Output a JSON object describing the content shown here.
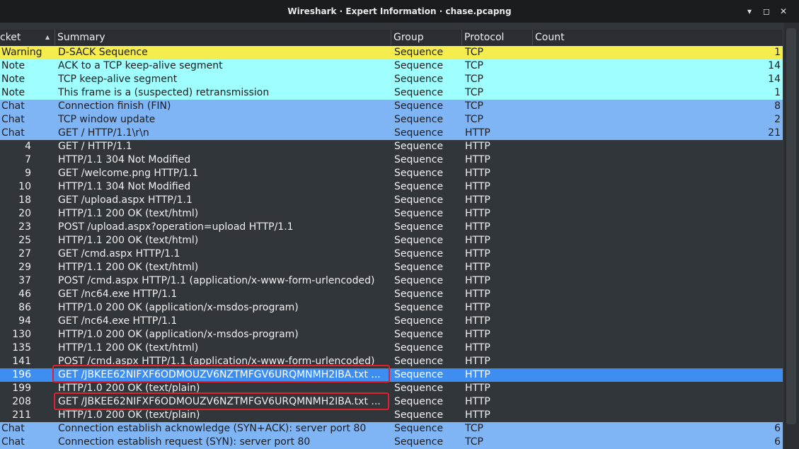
{
  "window": {
    "title": "Wireshark · Expert Information · chase.pcapng",
    "minimize_glyph": "▾",
    "restore_glyph": "◻",
    "maximize_glyph": "▴",
    "close_glyph": "✕"
  },
  "columns": {
    "packet": "cket",
    "summary": "Summary",
    "group": "Group",
    "protocol": "Protocol",
    "count": "Count"
  },
  "colors": {
    "warning": "#f5ed4e",
    "note": "#9fffff",
    "chat": "#7fb4f5",
    "selected": "#3d8ef0",
    "highlight_box": "#e0202a"
  },
  "rows": [
    {
      "kind": "warning",
      "packet": "Warning",
      "summary": "D-SACK Sequence",
      "group": "Sequence",
      "protocol": "TCP",
      "count": "1"
    },
    {
      "kind": "note",
      "packet": "Note",
      "summary": "ACK to a TCP keep-alive segment",
      "group": "Sequence",
      "protocol": "TCP",
      "count": "14"
    },
    {
      "kind": "note",
      "packet": "Note",
      "summary": "TCP keep-alive segment",
      "group": "Sequence",
      "protocol": "TCP",
      "count": "14"
    },
    {
      "kind": "note",
      "packet": "Note",
      "summary": "This frame is a (suspected) retransmission",
      "group": "Sequence",
      "protocol": "TCP",
      "count": "1"
    },
    {
      "kind": "chat",
      "packet": "Chat",
      "summary": "Connection finish (FIN)",
      "group": "Sequence",
      "protocol": "TCP",
      "count": "8"
    },
    {
      "kind": "chat",
      "packet": "Chat",
      "summary": "TCP window update",
      "group": "Sequence",
      "protocol": "TCP",
      "count": "2"
    },
    {
      "kind": "chat",
      "packet": "Chat",
      "summary": "GET / HTTP/1.1\\r\\n",
      "group": "Sequence",
      "protocol": "HTTP",
      "count": "21"
    },
    {
      "kind": "pkt",
      "packet": "4",
      "summary": "GET / HTTP/1.1",
      "group": "Sequence",
      "protocol": "HTTP",
      "count": ""
    },
    {
      "kind": "pkt",
      "packet": "7",
      "summary": "HTTP/1.1 304 Not Modified",
      "group": "Sequence",
      "protocol": "HTTP",
      "count": ""
    },
    {
      "kind": "pkt",
      "packet": "9",
      "summary": "GET /welcome.png HTTP/1.1",
      "group": "Sequence",
      "protocol": "HTTP",
      "count": ""
    },
    {
      "kind": "pkt",
      "packet": "10",
      "summary": "HTTP/1.1 304 Not Modified",
      "group": "Sequence",
      "protocol": "HTTP",
      "count": ""
    },
    {
      "kind": "pkt",
      "packet": "18",
      "summary": "GET /upload.aspx HTTP/1.1",
      "group": "Sequence",
      "protocol": "HTTP",
      "count": ""
    },
    {
      "kind": "pkt",
      "packet": "20",
      "summary": "HTTP/1.1 200 OK (text/html)",
      "group": "Sequence",
      "protocol": "HTTP",
      "count": ""
    },
    {
      "kind": "pkt",
      "packet": "23",
      "summary": "POST /upload.aspx?operation=upload HTTP/1.1",
      "group": "Sequence",
      "protocol": "HTTP",
      "count": ""
    },
    {
      "kind": "pkt",
      "packet": "25",
      "summary": "HTTP/1.1 200 OK (text/html)",
      "group": "Sequence",
      "protocol": "HTTP",
      "count": ""
    },
    {
      "kind": "pkt",
      "packet": "27",
      "summary": "GET /cmd.aspx HTTP/1.1",
      "group": "Sequence",
      "protocol": "HTTP",
      "count": ""
    },
    {
      "kind": "pkt",
      "packet": "29",
      "summary": "HTTP/1.1 200 OK (text/html)",
      "group": "Sequence",
      "protocol": "HTTP",
      "count": ""
    },
    {
      "kind": "pkt",
      "packet": "37",
      "summary": "POST /cmd.aspx HTTP/1.1 (application/x-www-form-urlencoded)",
      "group": "Sequence",
      "protocol": "HTTP",
      "count": ""
    },
    {
      "kind": "pkt",
      "packet": "46",
      "summary": "GET /nc64.exe HTTP/1.1",
      "group": "Sequence",
      "protocol": "HTTP",
      "count": ""
    },
    {
      "kind": "pkt",
      "packet": "86",
      "summary": "HTTP/1.0 200 OK (application/x-msdos-program)",
      "group": "Sequence",
      "protocol": "HTTP",
      "count": ""
    },
    {
      "kind": "pkt",
      "packet": "94",
      "summary": "GET /nc64.exe HTTP/1.1",
      "group": "Sequence",
      "protocol": "HTTP",
      "count": ""
    },
    {
      "kind": "pkt",
      "packet": "130",
      "summary": "HTTP/1.0 200 OK (application/x-msdos-program)",
      "group": "Sequence",
      "protocol": "HTTP",
      "count": ""
    },
    {
      "kind": "pkt",
      "packet": "135",
      "summary": "HTTP/1.1 200 OK (text/html)",
      "group": "Sequence",
      "protocol": "HTTP",
      "count": ""
    },
    {
      "kind": "pkt",
      "packet": "141",
      "summary": "POST /cmd.aspx HTTP/1.1 (application/x-www-form-urlencoded)",
      "group": "Sequence",
      "protocol": "HTTP",
      "count": ""
    },
    {
      "kind": "pkt selected",
      "packet": "196",
      "summary": "GET /JBKEE62NIFXF6ODMOUZV6NZTMFGV6URQMNMH2IBA.txt ...",
      "group": "Sequence",
      "protocol": "HTTP",
      "count": ""
    },
    {
      "kind": "pkt",
      "packet": "199",
      "summary": "HTTP/1.0 200 OK (text/plain)",
      "group": "Sequence",
      "protocol": "HTTP",
      "count": ""
    },
    {
      "kind": "pkt",
      "packet": "208",
      "summary": "GET /JBKEE62NIFXF6ODMOUZV6NZTMFGV6URQMNMH2IBA.txt ...",
      "group": "Sequence",
      "protocol": "HTTP",
      "count": ""
    },
    {
      "kind": "pkt",
      "packet": "211",
      "summary": "HTTP/1.0 200 OK (text/plain)",
      "group": "Sequence",
      "protocol": "HTTP",
      "count": ""
    },
    {
      "kind": "chat",
      "packet": "Chat",
      "summary": "Connection establish acknowledge (SYN+ACK): server port 80",
      "group": "Sequence",
      "protocol": "TCP",
      "count": "6"
    },
    {
      "kind": "chat",
      "packet": "Chat",
      "summary": "Connection establish request (SYN): server port 80",
      "group": "Sequence",
      "protocol": "TCP",
      "count": "6"
    }
  ]
}
